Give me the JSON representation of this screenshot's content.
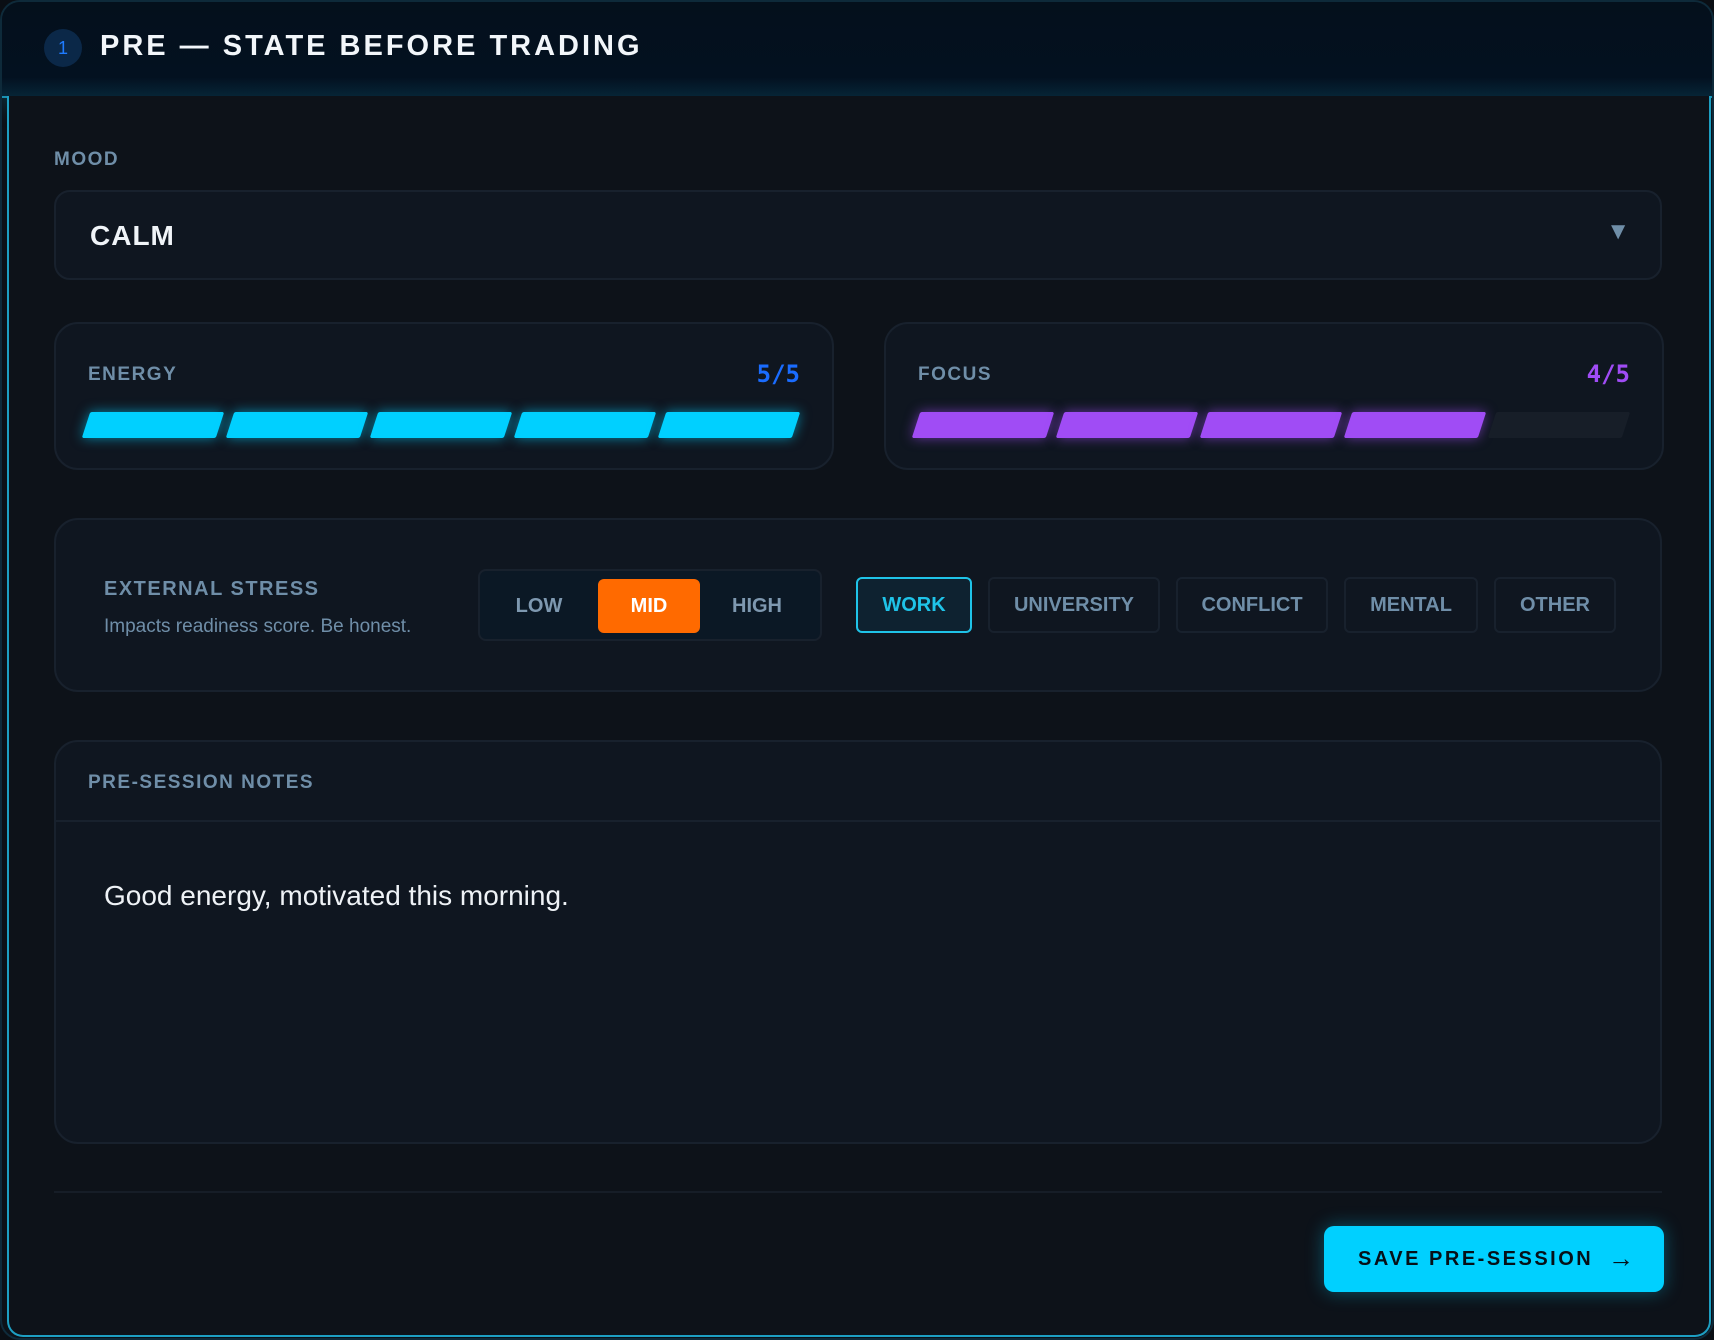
{
  "header": {
    "step_number": "1",
    "title": "PRE — STATE BEFORE TRADING"
  },
  "mood": {
    "label": "MOOD",
    "selected": "CALM"
  },
  "energy": {
    "label": "ENERGY",
    "value_text": "5/5",
    "value": 5,
    "max": 5,
    "color": "#00d0ff",
    "value_color": "#1a6cff"
  },
  "focus": {
    "label": "FOCUS",
    "value_text": "4/5",
    "value": 4,
    "max": 5,
    "color": "#a04cf5",
    "value_color": "#a04cf5"
  },
  "stress": {
    "title": "EXTERNAL STRESS",
    "hint": "Impacts readiness score. Be honest.",
    "levels": [
      "LOW",
      "MID",
      "HIGH"
    ],
    "selected_level": "MID",
    "level_accent": "#ff6a00",
    "sources": [
      "WORK",
      "UNIVERSITY",
      "CONFLICT",
      "MENTAL",
      "OTHER"
    ],
    "selected_source": "WORK"
  },
  "notes": {
    "label": "PRE-SESSION NOTES",
    "text": "Good energy, motivated this morning."
  },
  "actions": {
    "save_label": "SAVE PRE-SESSION",
    "save_icon": "arrow-right-icon"
  }
}
